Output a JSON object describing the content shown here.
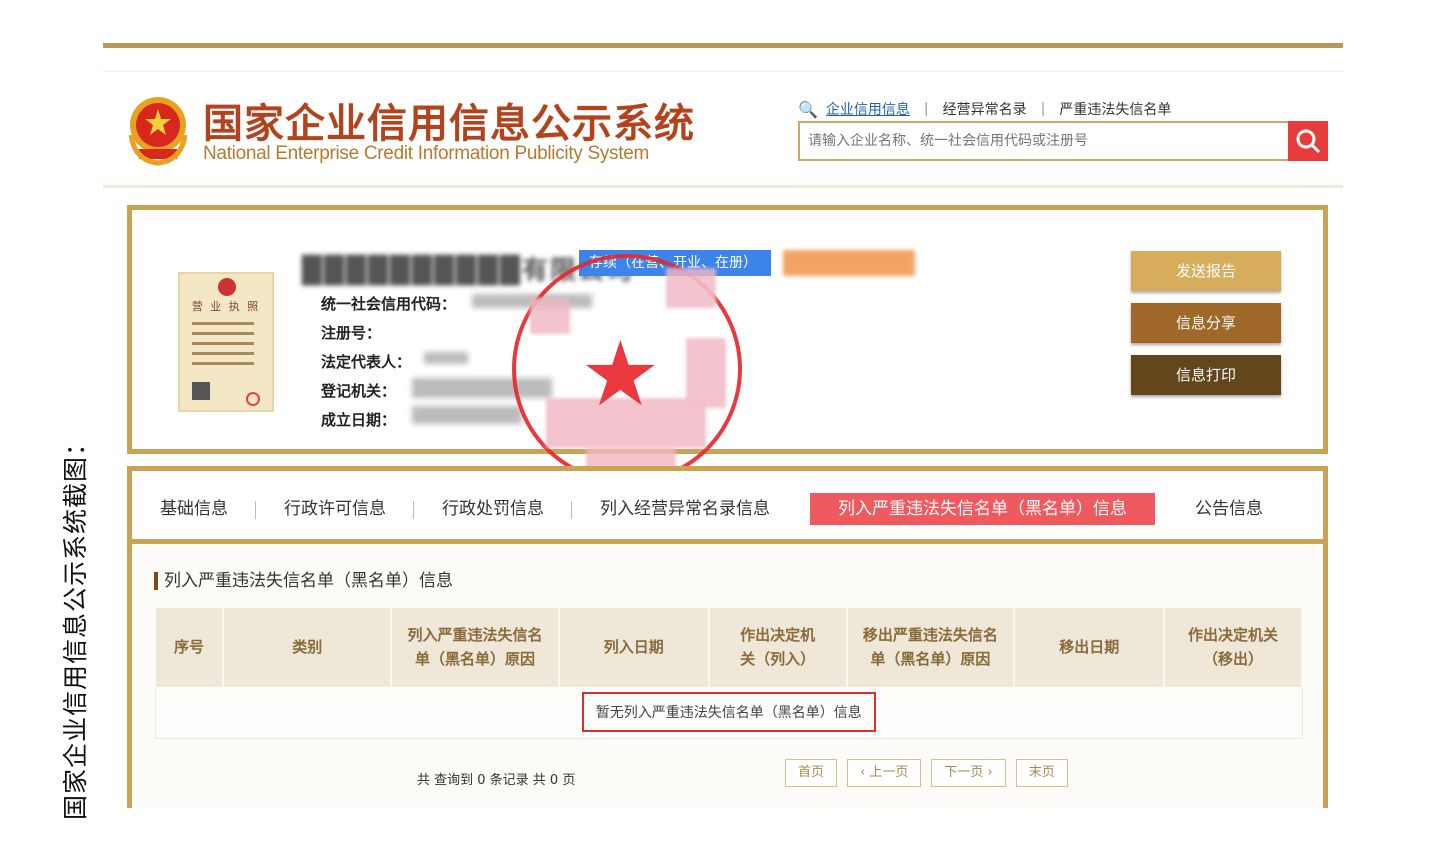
{
  "side_caption": "国家企业信用信息公示系统截图：",
  "header": {
    "title_cn": "国家企业信用信息公示系统",
    "title_en": "National Enterprise Credit Information Publicity System",
    "nav": [
      "企业信用信息",
      "经营异常名录",
      "严重违法失信名单"
    ],
    "search_placeholder": "请输入企业名称、统一社会信用代码或注册号"
  },
  "card": {
    "company_name": "██████████有限公司",
    "status_tag": "存续（在营、开业、在册）",
    "license_label": "营 业 执 照",
    "fields": [
      {
        "label": "统一社会信用代码："
      },
      {
        "label": "注册号："
      },
      {
        "label": "法定代表人："
      },
      {
        "label": "登记机关："
      },
      {
        "label": "成立日期："
      }
    ],
    "buttons": {
      "report": "发送报告",
      "share": "信息分享",
      "print": "信息打印"
    }
  },
  "tabs": [
    {
      "label": "基础信息"
    },
    {
      "label": "行政许可信息"
    },
    {
      "label": "行政处罚信息"
    },
    {
      "label": "列入经营异常名录信息"
    },
    {
      "label": "列入严重违法失信名单（黑名单）信息",
      "active": true
    },
    {
      "label": "公告信息"
    }
  ],
  "section": {
    "title": "列入严重违法失信名单（黑名单）信息",
    "columns": [
      "序号",
      "类别",
      "列入严重违法失信名单（黑名单）原因",
      "列入日期",
      "作出决定机关（列入）",
      "移出严重违法失信名单（黑名单）原因",
      "移出日期",
      "作出决定机关（移出）"
    ],
    "empty_message": "暂无列入严重违法失信名单（黑名单）信息"
  },
  "pager": {
    "summary": "共 查询到 0 条记录 共 0 页",
    "first": "首页",
    "prev": "‹ 上一页",
    "next": "下一页 ›",
    "last": "末页"
  },
  "colors": {
    "accent_gold": "#c9a253",
    "title_red": "#b4431d",
    "active_tab": "#ef5a5f",
    "search_red": "#e63c3c"
  }
}
